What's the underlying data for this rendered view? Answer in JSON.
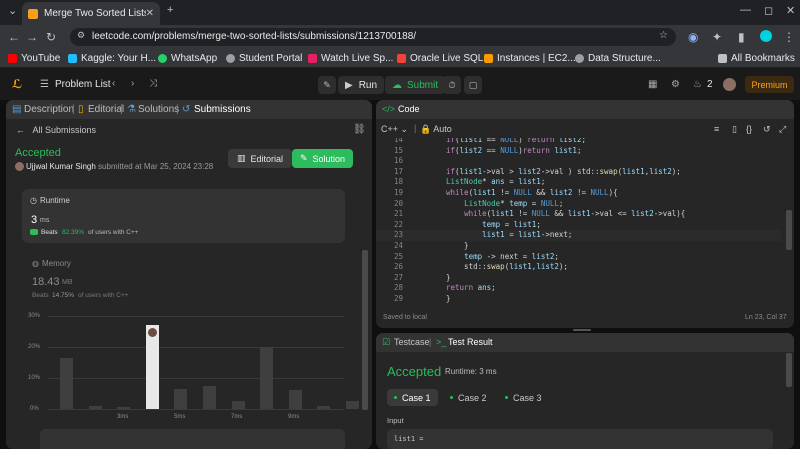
{
  "browser": {
    "tab_title": "Merge Two Sorted Lists",
    "url": "leetcode.com/problems/merge-two-sorted-lists/submissions/1213700188/",
    "bookmarks": [
      {
        "label": "YouTube",
        "color": "#ff0000"
      },
      {
        "label": "Kaggle: Your H...",
        "color": "#20beff"
      },
      {
        "label": "WhatsApp",
        "color": "#25d366"
      },
      {
        "label": "Student Portal",
        "color": "#9aa0a6"
      },
      {
        "label": "Watch Live Sp...",
        "color": "#e91e63"
      },
      {
        "label": "Oracle Live SQL",
        "color": "#f44336"
      },
      {
        "label": "Instances | EC2...",
        "color": "#ff9900"
      },
      {
        "label": "Data Structure...",
        "color": "#9aa0a6"
      }
    ],
    "all_bookmarks": "All Bookmarks"
  },
  "nav": {
    "problem_list": "Problem List",
    "run": "Run",
    "submit": "Submit",
    "streak": "2",
    "premium": "Premium"
  },
  "left": {
    "tabs": [
      "Description",
      "Editorial",
      "Solutions",
      "Submissions"
    ],
    "all_submissions": "All Submissions",
    "status": "Accepted",
    "user": "Ujjwal Kumar Singh",
    "submitted_text": "submitted at Mar 25, 2024 23:28",
    "editorial_btn": "Editorial",
    "solution_btn": "Solution",
    "runtime": {
      "title": "Runtime",
      "value": "3",
      "unit": "ms",
      "beats_label": "Beats",
      "beats_value": "82.39%",
      "beats_suffix": "of users with C++"
    },
    "memory": {
      "title": "Memory",
      "value": "18.43",
      "unit": "MB",
      "beats_label": "Beats",
      "beats_value": "14.75%",
      "beats_suffix": "of users with C++"
    }
  },
  "chart_data": {
    "type": "bar",
    "y_ticks": [
      "30%",
      "20%",
      "10%",
      "0%"
    ],
    "ylim": [
      0,
      30
    ],
    "x_labels": [
      "3ms",
      "5ms",
      "7ms",
      "9ms"
    ],
    "values": [
      16.5,
      1,
      0,
      27,
      6.5,
      7.5,
      2.5,
      20,
      6,
      1,
      2.5
    ],
    "highlight_index": 3
  },
  "code": {
    "tab": "Code",
    "language": "C++",
    "auto": "Auto",
    "saved": "Saved to local",
    "position": "Ln 23, Col 37",
    "lines": [
      {
        "n": "14",
        "t": "if(list1 == NULL) return list2;"
      },
      {
        "n": "15",
        "t": "if(list2 == NULL)return list1;"
      },
      {
        "n": "16",
        "t": ""
      },
      {
        "n": "17",
        "t": "if(list1->val > list2->val ) std::swap(list1,list2);"
      },
      {
        "n": "18",
        "t": "ListNode* ans = list1;"
      },
      {
        "n": "19",
        "t": "while(list1 != NULL && list2 != NULL){"
      },
      {
        "n": "20",
        "t": "    ListNode* temp = NULL;"
      },
      {
        "n": "21",
        "t": "    while(list1 != NULL && list1->val <= list2->val){"
      },
      {
        "n": "22",
        "t": "        temp = list1;"
      },
      {
        "n": "23",
        "t": "        list1 = list1->next;"
      },
      {
        "n": "24",
        "t": "    }"
      },
      {
        "n": "25",
        "t": "    temp -> next = list2;"
      },
      {
        "n": "26",
        "t": "    std::swap(list1,list2);"
      },
      {
        "n": "27",
        "t": "}"
      },
      {
        "n": "28",
        "t": "return ans;"
      },
      {
        "n": "29",
        "t": "}"
      }
    ]
  },
  "result": {
    "tab_testcase": "Testcase",
    "tab_result": "Test Result",
    "status": "Accepted",
    "runtime": "Runtime: 3 ms",
    "cases": [
      "Case 1",
      "Case 2",
      "Case 3"
    ],
    "input_label": "Input",
    "input_value": "list1 ="
  }
}
